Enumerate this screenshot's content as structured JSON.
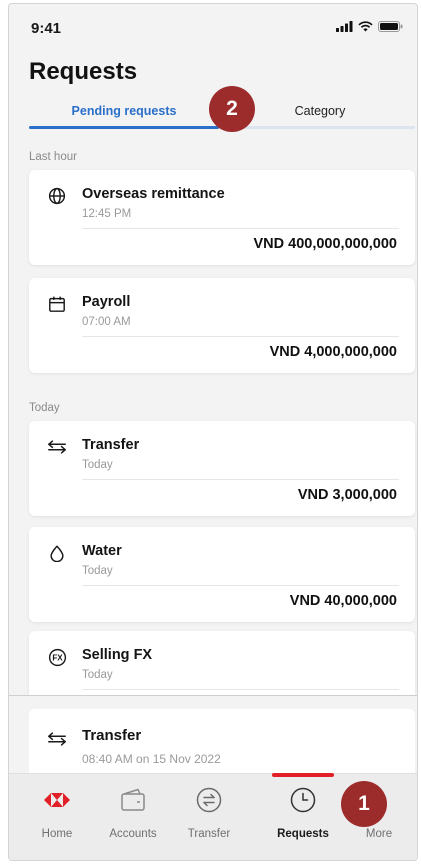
{
  "status_bar": {
    "time": "9:41"
  },
  "page": {
    "title": "Requests"
  },
  "tabs": [
    {
      "label": "Pending requests",
      "active": true
    },
    {
      "label": "Category",
      "active": false
    }
  ],
  "annotations": {
    "badge_tabs": "2",
    "badge_more": "1"
  },
  "sections": {
    "last_hour": "Last hour",
    "today": "Today"
  },
  "requests": [
    {
      "title": "Overseas remittance",
      "time": "12:45 PM",
      "amount": "VND 400,000,000,000",
      "icon": "globe-icon"
    },
    {
      "title": "Payroll",
      "time": "07:00 AM",
      "amount": "VND 4,000,000,000",
      "icon": "calendar-icon"
    },
    {
      "title": "Transfer",
      "time": "Today",
      "amount": "VND 3,000,000",
      "icon": "transfer-arrows-icon"
    },
    {
      "title": "Water",
      "time": "Today",
      "amount": "VND 40,000,000",
      "icon": "water-drop-icon"
    },
    {
      "title": "Selling FX",
      "time": "Today",
      "amount": "",
      "icon": "fx-icon"
    }
  ],
  "sheet": {
    "title": "Transfer",
    "time": "08:40 AM on 15 Nov 2022",
    "icon": "transfer-arrows-icon"
  },
  "nav": [
    {
      "label": "Home",
      "icon": "home-logo-icon",
      "active": false
    },
    {
      "label": "Accounts",
      "icon": "wallet-icon",
      "active": false
    },
    {
      "label": "Transfer",
      "icon": "transfer-circle-icon",
      "active": false
    },
    {
      "label": "Requests",
      "icon": "clock-icon",
      "active": true
    },
    {
      "label": "More",
      "icon": "more-icon",
      "active": false
    }
  ],
  "colors": {
    "brand_red": "#e21f26",
    "accent_blue": "#2a6fc9",
    "badge_red": "#9c2b2b"
  }
}
